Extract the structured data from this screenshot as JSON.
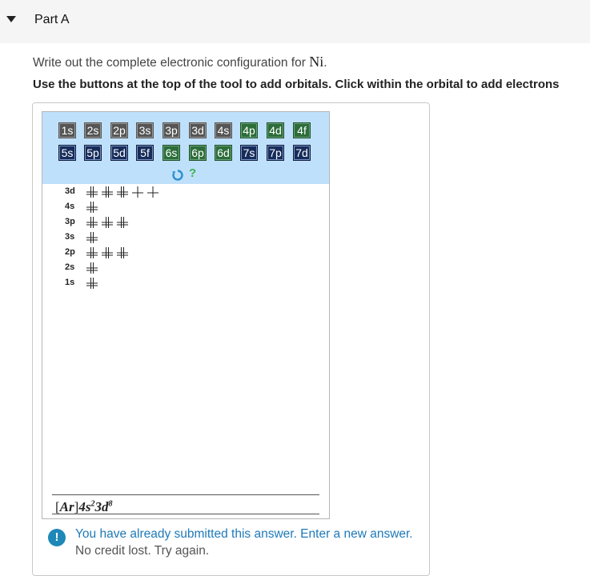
{
  "header": {
    "title": "Part A"
  },
  "question": {
    "prefix": "Write out the complete electronic configuration for ",
    "element": "Ni",
    "suffix": "."
  },
  "instruction": "Use the buttons at the top of the tool to add orbitals. Click within the orbital to add electrons",
  "toolbar": {
    "row1": [
      {
        "label": "1s",
        "style": "gray"
      },
      {
        "label": "2s",
        "style": "gray"
      },
      {
        "label": "2p",
        "style": "gray"
      },
      {
        "label": "3s",
        "style": "gray"
      },
      {
        "label": "3p",
        "style": "gray"
      },
      {
        "label": "3d",
        "style": "gray"
      },
      {
        "label": "4s",
        "style": "gray"
      },
      {
        "label": "4p",
        "style": "green"
      },
      {
        "label": "4d",
        "style": "green"
      },
      {
        "label": "4f",
        "style": "green"
      }
    ],
    "row2": [
      {
        "label": "5s",
        "style": "navy"
      },
      {
        "label": "5p",
        "style": "navy"
      },
      {
        "label": "5d",
        "style": "navy"
      },
      {
        "label": "5f",
        "style": "navy"
      },
      {
        "label": "6s",
        "style": "green"
      },
      {
        "label": "6p",
        "style": "green"
      },
      {
        "label": "6d",
        "style": "green"
      },
      {
        "label": "7s",
        "style": "navy"
      },
      {
        "label": "7p",
        "style": "navy"
      },
      {
        "label": "7d",
        "style": "navy"
      }
    ],
    "undo_icon": "undo-icon",
    "help_label": "?"
  },
  "orbitals": [
    {
      "label": "3d",
      "boxes": [
        "paired",
        "paired",
        "paired",
        "single",
        "single"
      ]
    },
    {
      "label": "4s",
      "boxes": [
        "paired"
      ]
    },
    {
      "label": "3p",
      "boxes": [
        "paired",
        "paired",
        "paired"
      ]
    },
    {
      "label": "3s",
      "boxes": [
        "paired"
      ]
    },
    {
      "label": "2p",
      "boxes": [
        "paired",
        "paired",
        "paired"
      ]
    },
    {
      "label": "2s",
      "boxes": [
        "paired"
      ]
    },
    {
      "label": "1s",
      "boxes": [
        "paired"
      ]
    }
  ],
  "answer": {
    "core": "Ar",
    "orbital1": "4s",
    "exp1": "2",
    "orbital2": "3d",
    "exp2": "8"
  },
  "alert": {
    "main": "You have already submitted this answer. Enter a new answer.",
    "sub": "No credit lost. Try again.",
    "icon_label": "!"
  },
  "colors": {
    "gray_button": "#555555",
    "green_button": "#2c6d3a",
    "navy_button": "#162c5a",
    "toolbar_bg": "#bfe0fb",
    "alert_blue": "#1e79b8"
  }
}
